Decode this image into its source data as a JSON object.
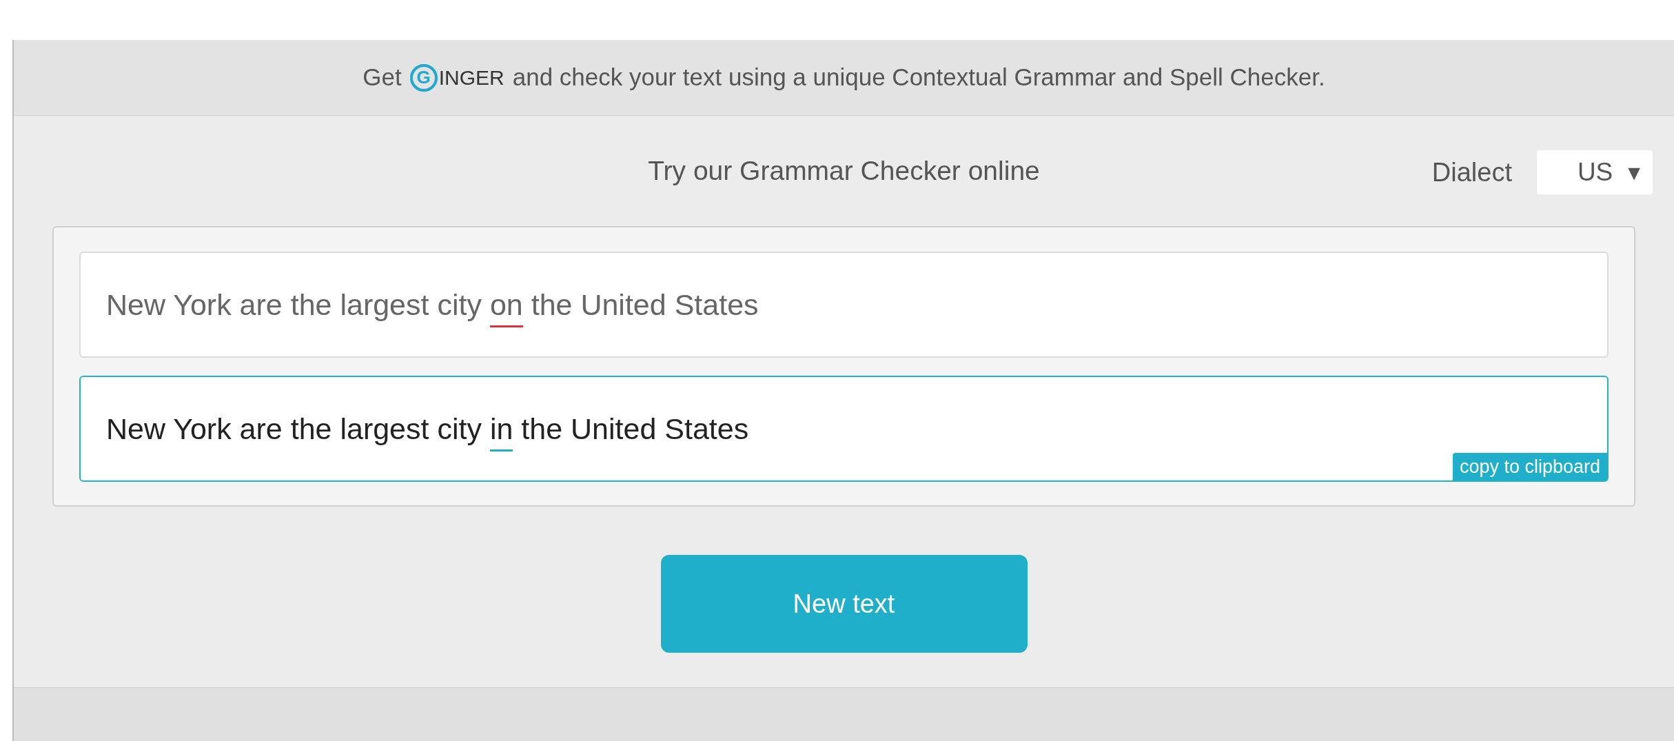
{
  "banner": {
    "before": "Get",
    "logo": {
      "initial": "G",
      "rest": "INGER"
    },
    "after": "and check your text using a unique Contextual Grammar and Spell Checker."
  },
  "heading": "Try our Grammar Checker online",
  "dialect": {
    "label": "Dialect",
    "value": "US",
    "arrow": "▼"
  },
  "original": [
    {
      "text": "New York are the largest city ",
      "kind": "plain"
    },
    {
      "text": "on",
      "kind": "error"
    },
    {
      "text": " the United States",
      "kind": "plain"
    }
  ],
  "corrected": [
    {
      "text": "New York are the largest city ",
      "kind": "plain"
    },
    {
      "text": "in",
      "kind": "fix"
    },
    {
      "text": " the United States",
      "kind": "plain"
    }
  ],
  "copy_button": "copy to clipboard",
  "new_text_button": "New text"
}
